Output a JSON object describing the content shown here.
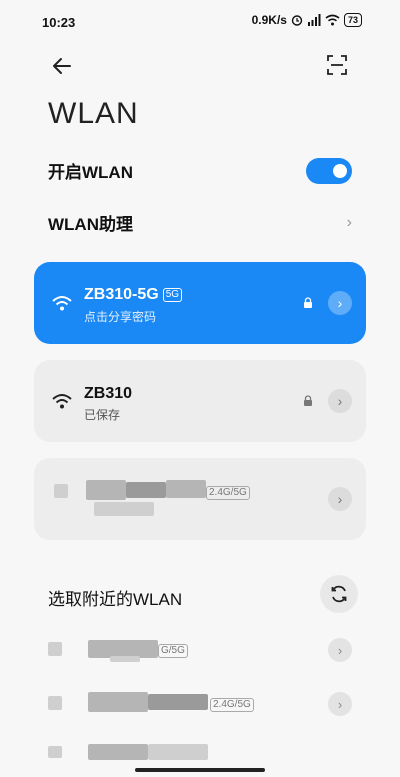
{
  "status": {
    "time": "10:23",
    "speed": "0.9K/s",
    "battery": "73"
  },
  "page": {
    "title": "WLAN"
  },
  "settings": {
    "enable_label": "开启WLAN",
    "enable_on": true,
    "assistant_label": "WLAN助理"
  },
  "saved_networks": [
    {
      "name": "ZB310-5G",
      "band": "5G",
      "sub": "点击分享密码",
      "locked": true,
      "active": true
    },
    {
      "name": "ZB310",
      "sub": "已保存",
      "locked": true,
      "active": false
    },
    {
      "band": "2.4G/5G"
    }
  ],
  "nearby": {
    "title": "选取附近的WLAN",
    "items": [
      {
        "band": "G/5G"
      },
      {
        "band": "2.4G/5G"
      }
    ]
  },
  "colors": {
    "accent": "#1a88f5"
  },
  "icons": [
    "back-arrow-icon",
    "scan-icon",
    "wifi-icon",
    "lock-icon",
    "chevron-right-icon",
    "refresh-icon"
  ]
}
